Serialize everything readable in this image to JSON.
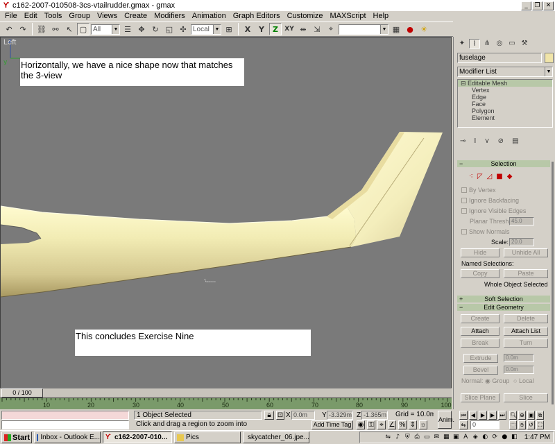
{
  "window": {
    "title": "c162-2007-010508-3cs-vtailrudder.gmax - gmax",
    "app_icon": "gmax-icon",
    "minimize": "_",
    "restore": "❐",
    "close": "✕"
  },
  "menu": [
    "File",
    "Edit",
    "Tools",
    "Group",
    "Views",
    "Create",
    "Modifiers",
    "Animation",
    "Graph Editors",
    "Customize",
    "MAXScript",
    "Help"
  ],
  "toolbar": {
    "selection_filter": "All",
    "reference_coord": "Local",
    "constraint_labels": [
      "X",
      "Y",
      "Z",
      "XY"
    ]
  },
  "viewport": {
    "label": "Left",
    "note_top": "Horizontally, we have a nice shape now that matches the 3-view",
    "note_bottom": "This concludes Exercise Nine",
    "axis_z": "z",
    "axis_y": "y",
    "background_color": "#7a7a7a",
    "mesh_color": "#f2ecb4"
  },
  "timeline": {
    "slider_label": "0 / 100",
    "ticks": [
      "10",
      "20",
      "30",
      "40",
      "50",
      "60",
      "70",
      "80",
      "90",
      "100"
    ]
  },
  "status": {
    "selected": "1 Object Selected",
    "prompt": "Click and drag a region to zoom into",
    "x_label": "X",
    "x_value": "0.0m",
    "y_label": "Y",
    "y_value": "-3.329m",
    "z_label": "Z",
    "z_value": "-1.365m",
    "grid": "Grid = 10.0m",
    "add_time_tag": "Add Time Tag",
    "anim_button": "Anim.",
    "frame_value": "0"
  },
  "command_panel": {
    "object_name": "fuselage",
    "object_color": "#f0e4a8",
    "modifier_list": "Modifier List",
    "stack": [
      "Editable Mesh",
      "Vertex",
      "Edge",
      "Face",
      "Polygon",
      "Element"
    ],
    "selection_title": "Selection",
    "by_vertex": "By Vertex",
    "ignore_backfacing": "Ignore Backfacing",
    "ignore_visible_edges": "Ignore Visible Edges",
    "planar_thresh_label": "Planar Thresh",
    "planar_thresh_value": "45.0",
    "show_normals": "Show Normals",
    "scale_label": "Scale:",
    "scale_value": "20.0",
    "hide": "Hide",
    "unhide_all": "Unhide All",
    "named_selections": "Named Selections:",
    "copy": "Copy",
    "paste": "Paste",
    "whole_object": "Whole Object Selected",
    "soft_selection": "Soft Selection",
    "edit_geometry": "Edit Geometry",
    "create": "Create",
    "delete": "Delete",
    "attach": "Attach",
    "attach_list": "Attach List",
    "break": "Break",
    "turn": "Turn",
    "extrude": "Extrude",
    "extrude_value": "0.0m",
    "bevel": "Bevel",
    "bevel_value": "0.0m",
    "normal_label": "Normal:",
    "normal_group": "Group",
    "normal_local": "Local",
    "slice_plane": "Slice Plane",
    "slice": "Slice"
  },
  "taskbar": {
    "start": "Start",
    "tasks": [
      "Inbox - Outlook E...",
      "c162-2007-010...",
      "Pics",
      "skycatcher_06.jpe..."
    ],
    "active_index": 1,
    "clock": "1:47 PM"
  }
}
